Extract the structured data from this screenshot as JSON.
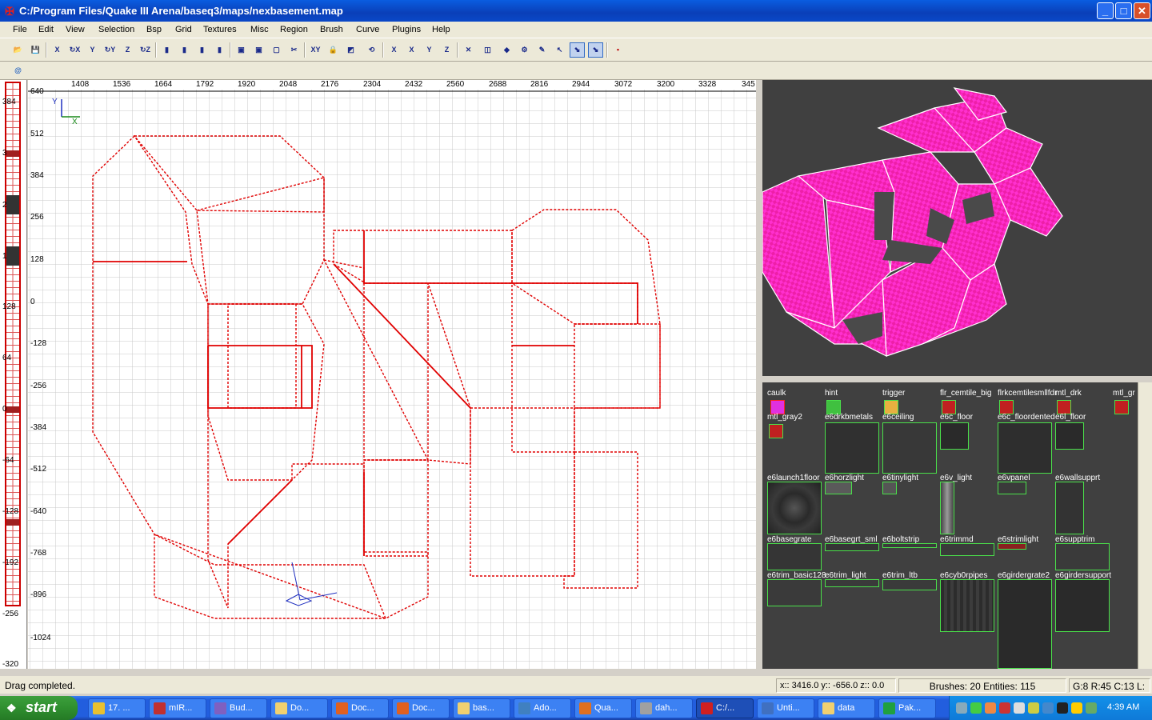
{
  "window": {
    "title": "C:/Program Files/Quake III Arena/baseq3/maps/nexbasement.map",
    "minimize": "_",
    "maximize": "□",
    "close": "✕"
  },
  "menu": [
    "File",
    "Edit",
    "View",
    "Selection",
    "Bsp",
    "Grid",
    "Textures",
    "Misc",
    "Region",
    "Brush",
    "Curve",
    "Plugins",
    "Help"
  ],
  "toolbar": {
    "buttons": [
      {
        "name": "open-icon",
        "glyph": "📂"
      },
      {
        "name": "save-icon",
        "glyph": "💾"
      },
      {
        "name": "flip-x-icon",
        "glyph": "X"
      },
      {
        "name": "rotate-x-icon",
        "glyph": "↻X"
      },
      {
        "name": "flip-y-icon",
        "glyph": "Y"
      },
      {
        "name": "rotate-y-icon",
        "glyph": "↻Y"
      },
      {
        "name": "flip-z-icon",
        "glyph": "Z"
      },
      {
        "name": "rotate-z-icon",
        "glyph": "↻Z"
      },
      {
        "name": "complete-tall-icon",
        "glyph": "▮"
      },
      {
        "name": "select-touching-icon",
        "glyph": "▮"
      },
      {
        "name": "select-partial-icon",
        "glyph": "▮"
      },
      {
        "name": "select-inside-icon",
        "glyph": "▮"
      },
      {
        "name": "csg-subtract-icon",
        "glyph": "▣"
      },
      {
        "name": "csg-merge-icon",
        "glyph": "▣"
      },
      {
        "name": "hollow-icon",
        "glyph": "▢"
      },
      {
        "name": "clipper-icon",
        "glyph": "✂"
      },
      {
        "name": "change-views-icon",
        "glyph": "XY"
      },
      {
        "name": "texture-lock-icon",
        "glyph": "🔒"
      },
      {
        "name": "cubic-clip-icon",
        "glyph": "◩"
      },
      {
        "name": "camera-icon",
        "glyph": "⟲"
      },
      {
        "name": "view-x-icon",
        "glyph": "X"
      },
      {
        "name": "view-xy-icon",
        "glyph": "X"
      },
      {
        "name": "view-y-icon",
        "glyph": "Y"
      },
      {
        "name": "view-z-icon",
        "glyph": "Z"
      },
      {
        "name": "show-models-icon",
        "glyph": "✕"
      },
      {
        "name": "show-ents-icon",
        "glyph": "◫"
      },
      {
        "name": "patch-icon",
        "glyph": "◆"
      },
      {
        "name": "bend-icon",
        "glyph": "⚙"
      },
      {
        "name": "weld-icon",
        "glyph": "✎"
      },
      {
        "name": "drag-edges-icon",
        "glyph": "↖"
      },
      {
        "name": "drag-vertices-icon",
        "glyph": "⬊"
      },
      {
        "name": "plugin-icon",
        "glyph": "▪"
      }
    ],
    "plugin_bar_icon": "@"
  },
  "xy_view": {
    "top_ruler": [
      "1408",
      "1536",
      "1664",
      "1792",
      "1920",
      "2048",
      "2176",
      "2304",
      "2432",
      "2560",
      "2688",
      "2816",
      "2944",
      "3072",
      "3200",
      "3328",
      "345"
    ],
    "left_ruler": [
      "640",
      "512",
      "384",
      "256",
      "128",
      "0",
      "-128",
      "-256",
      "-384",
      "-512",
      "-640",
      "-768",
      "-896",
      "-1024"
    ],
    "axis_x": "X",
    "axis_y": "Y"
  },
  "z_view": {
    "ruler": [
      "384",
      "3",
      "2",
      "1",
      "128",
      "0",
      "64",
      "-64",
      "-128",
      "-192",
      "-256",
      "-320"
    ]
  },
  "textures": [
    {
      "label": "caulk",
      "color": "#e030e0"
    },
    {
      "label": "hint",
      "color": "#40c040"
    },
    {
      "label": "trigger",
      "color": "#e8b040"
    },
    {
      "label": "flr_cemtile_big",
      "color": "#c02020"
    },
    {
      "label": "flrkcemtilesmllfdr",
      "color": "#c02020"
    },
    {
      "label": "mtl_drk",
      "color": "#c02020"
    },
    {
      "label": "mtl_gr",
      "color": "#c02020"
    },
    {
      "label": "mtl_gray2",
      "color": "#c02020"
    },
    {
      "label": "e6drkbmetals",
      "color": "#303030"
    },
    {
      "label": "e6ceiling",
      "color": "#383838"
    },
    {
      "label": "e6c_floor",
      "color": "#2a2a2a"
    },
    {
      "label": "e6c_floordented",
      "color": "#2e2e2e"
    },
    {
      "label": "e6l_floor",
      "color": "#2a2a2a"
    },
    {
      "label": "e6launch1floor",
      "color": "#353535"
    },
    {
      "label": "e6horzlight",
      "color": "#5a5a5a"
    },
    {
      "label": "e6tinylight",
      "color": "#555555"
    },
    {
      "label": "e6v_light",
      "color": "#666666"
    },
    {
      "label": "e6vpanel",
      "color": "#3a3a3a"
    },
    {
      "label": "e6wallsupprt",
      "color": "#333333"
    },
    {
      "label": "e6basegrate",
      "color": "#353535"
    },
    {
      "label": "e6basegrt_sml",
      "color": "#353535"
    },
    {
      "label": "e6boltstrip",
      "color": "#3a3a3a"
    },
    {
      "label": "e6trimmd",
      "color": "#3a3a3a"
    },
    {
      "label": "e6strimlight",
      "color": "#8a2020"
    },
    {
      "label": "e6supptrim",
      "color": "#3a3a3a"
    },
    {
      "label": "e6trim_basic128",
      "color": "#3a3a3a"
    },
    {
      "label": "e6trim_light",
      "color": "#3a3a3a"
    },
    {
      "label": "e6trim_ltb",
      "color": "#3a3a3a"
    },
    {
      "label": "e6cyb0rpipes",
      "color": "#2c2c2c"
    },
    {
      "label": "e6girdergrate2",
      "color": "#2a2a2a"
    },
    {
      "label": "e6girdersupport",
      "color": "#2a2a2a"
    }
  ],
  "status": {
    "message": "Drag completed.",
    "coords": "x:: 3416.0  y:: -656.0  z:: 0.0",
    "counts": "Brushes: 20 Entities: 115",
    "grid": "G:8 R:45 C:13 L:"
  },
  "taskbar": {
    "start": "start",
    "items": [
      {
        "label": "17. ...",
        "color": "#e8c030"
      },
      {
        "label": "mIR...",
        "color": "#c03030"
      },
      {
        "label": "Bud...",
        "color": "#8060c0"
      },
      {
        "label": "Do...",
        "color": "#f0d070"
      },
      {
        "label": "Doc...",
        "color": "#e06020"
      },
      {
        "label": "Doc...",
        "color": "#e06020"
      },
      {
        "label": "bas...",
        "color": "#f0d070"
      },
      {
        "label": "Ado...",
        "color": "#4080c0"
      },
      {
        "label": "Qua...",
        "color": "#e07020"
      },
      {
        "label": "dah...",
        "color": "#a0a0a0"
      },
      {
        "label": "C:/...",
        "color": "#d02020"
      },
      {
        "label": "Unti...",
        "color": "#4070c0"
      },
      {
        "label": "data",
        "color": "#f0d070"
      },
      {
        "label": "Pak...",
        "color": "#20a040"
      }
    ],
    "clock": "4:39 AM"
  }
}
